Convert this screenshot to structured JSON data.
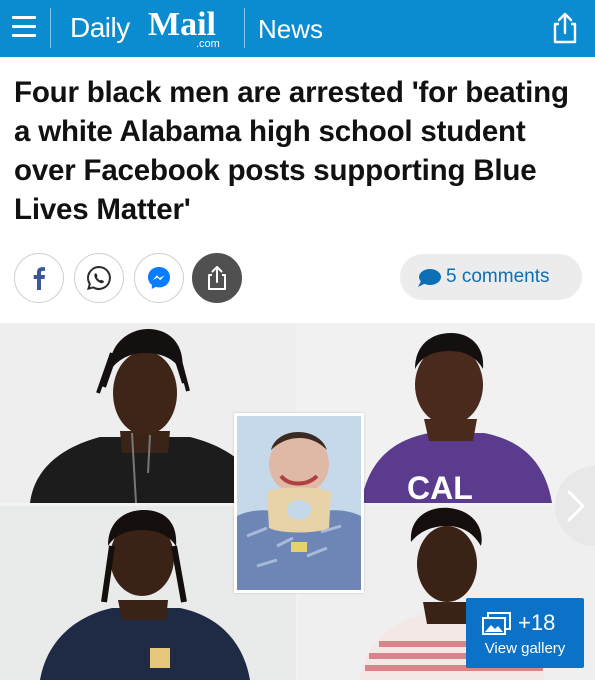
{
  "header": {
    "logo_daily": "Daily",
    "logo_mail": "Mail",
    "logo_com": ".com",
    "section": "News",
    "menu_icon": "hamburger-menu-icon",
    "share_icon": "share-icon"
  },
  "article": {
    "headline": "Four black men are arrested 'for beating a white Alabama high school student over Facebook posts supporting Blue Lives Matter'"
  },
  "share_bar": {
    "buttons": [
      {
        "icon": "facebook-icon"
      },
      {
        "icon": "whatsapp-icon"
      },
      {
        "icon": "messenger-icon"
      },
      {
        "icon": "share-icon"
      }
    ],
    "comments_label": "5 comments"
  },
  "gallery": {
    "count_label": "+18",
    "view_label": "View gallery",
    "shirt_text": "CAL",
    "next_icon": "chevron-right-icon"
  },
  "colors": {
    "brand_blue": "#0b8bd0",
    "gallery_blue": "#0b72c7",
    "comment_blue": "#0b6fb5"
  }
}
